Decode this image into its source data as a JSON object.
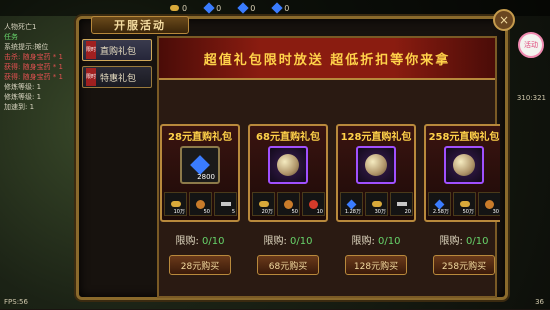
{
  "hud": {
    "resources": [
      {
        "icon": "gold-coin-icon",
        "value": "0"
      },
      {
        "icon": "blue-gem-icon",
        "value": "0"
      },
      {
        "icon": "blue-gem-icon",
        "value": "0"
      },
      {
        "icon": "blue-gem-icon",
        "value": "0"
      }
    ],
    "fps": "FPS:56",
    "coords": "310:321",
    "time": "36",
    "badge": "活动"
  },
  "log": [
    {
      "text": "人物死亡1",
      "cls": "w"
    },
    {
      "text": "任务",
      "cls": "g"
    },
    {
      "text": "系统提示:摊位",
      "cls": "w"
    },
    {
      "text": "击杀: 随身宝药 * 1",
      "cls": "r"
    },
    {
      "text": "获得: 随身宝药 * 1",
      "cls": "r"
    },
    {
      "text": "获得: 随身宝药 * 1",
      "cls": "r"
    },
    {
      "text": "修炼等级: 1",
      "cls": "w"
    },
    {
      "text": "修炼等级: 1",
      "cls": "w"
    },
    {
      "text": "加速到: 1",
      "cls": "w"
    }
  ],
  "window": {
    "title": "开服活动",
    "close": "×",
    "tabs": [
      {
        "label": "直购礼包",
        "flag": "限时",
        "active": true
      },
      {
        "label": "特惠礼包",
        "flag": "限时",
        "active": false
      }
    ],
    "banner": "超值礼包限时放送  超低折扣等你来拿"
  },
  "packs": [
    {
      "title": "28元直购礼包",
      "main": "gem",
      "main_label": "2800",
      "items": [
        [
          "gold",
          "10万"
        ],
        [
          "bag",
          "50"
        ],
        [
          "key",
          "5"
        ]
      ],
      "limit_label": "限购:",
      "limit": "0/10",
      "buy": "28元购买"
    },
    {
      "title": "68元直购礼包",
      "main": "orb",
      "main_label": "",
      "items": [
        [
          "gold",
          "20万"
        ],
        [
          "bag",
          "50"
        ],
        [
          "red",
          "10"
        ]
      ],
      "limit_label": "限购:",
      "limit": "0/10",
      "buy": "68元购买"
    },
    {
      "title": "128元直购礼包",
      "main": "orb",
      "main_label": "",
      "items": [
        [
          "gem",
          "1.28万"
        ],
        [
          "gold",
          "30万"
        ],
        [
          "key",
          "20"
        ]
      ],
      "limit_label": "限购:",
      "limit": "0/10",
      "buy": "128元购买"
    },
    {
      "title": "258元直购礼包",
      "main": "orb",
      "main_label": "",
      "items": [
        [
          "gem",
          "2.58万"
        ],
        [
          "gold",
          "50万"
        ],
        [
          "bag",
          "30"
        ]
      ],
      "limit_label": "限购:",
      "limit": "0/10",
      "buy": "258元购买"
    }
  ]
}
